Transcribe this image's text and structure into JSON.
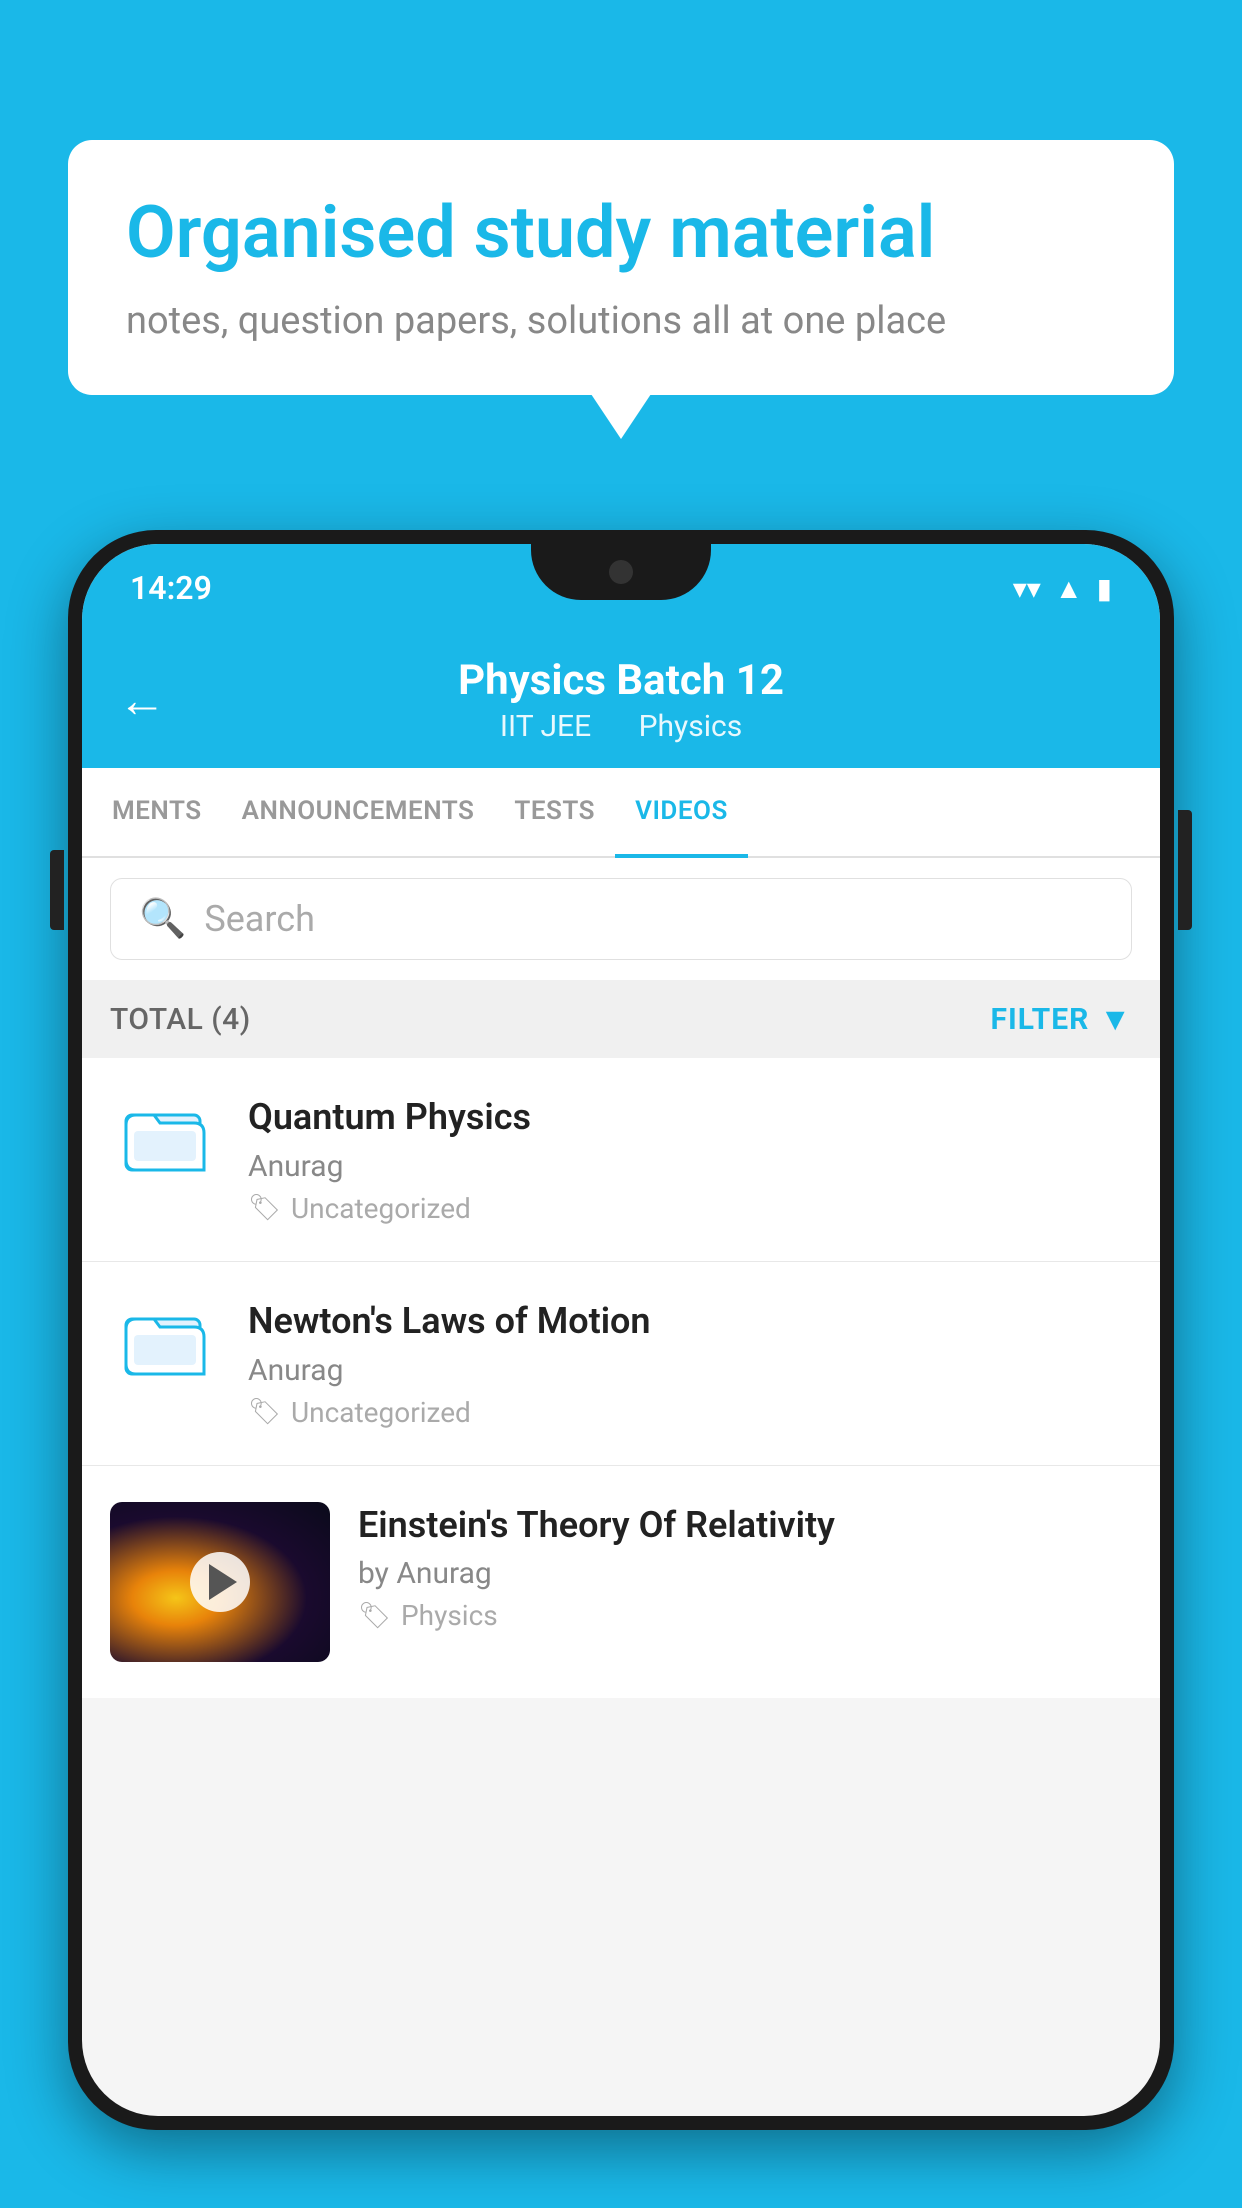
{
  "background_color": "#1ab8e8",
  "bubble": {
    "title": "Organised study material",
    "subtitle": "notes, question papers, solutions all at one place"
  },
  "status_bar": {
    "time": "14:29",
    "wifi": "▼",
    "signal": "▲",
    "battery": "▮"
  },
  "header": {
    "back_label": "←",
    "title": "Physics Batch 12",
    "tag1": "IIT JEE",
    "tag2": "Physics"
  },
  "tabs": [
    {
      "label": "MENTS",
      "active": false
    },
    {
      "label": "ANNOUNCEMENTS",
      "active": false
    },
    {
      "label": "TESTS",
      "active": false
    },
    {
      "label": "VIDEOS",
      "active": true
    }
  ],
  "search": {
    "placeholder": "Search"
  },
  "filter_bar": {
    "total_label": "TOTAL (4)",
    "filter_label": "FILTER"
  },
  "videos": [
    {
      "title": "Quantum Physics",
      "author": "Anurag",
      "tag": "Uncategorized",
      "has_thumbnail": false
    },
    {
      "title": "Newton's Laws of Motion",
      "author": "Anurag",
      "tag": "Uncategorized",
      "has_thumbnail": false
    },
    {
      "title": "Einstein's Theory Of Relativity",
      "author": "by Anurag",
      "tag": "Physics",
      "has_thumbnail": true
    }
  ]
}
